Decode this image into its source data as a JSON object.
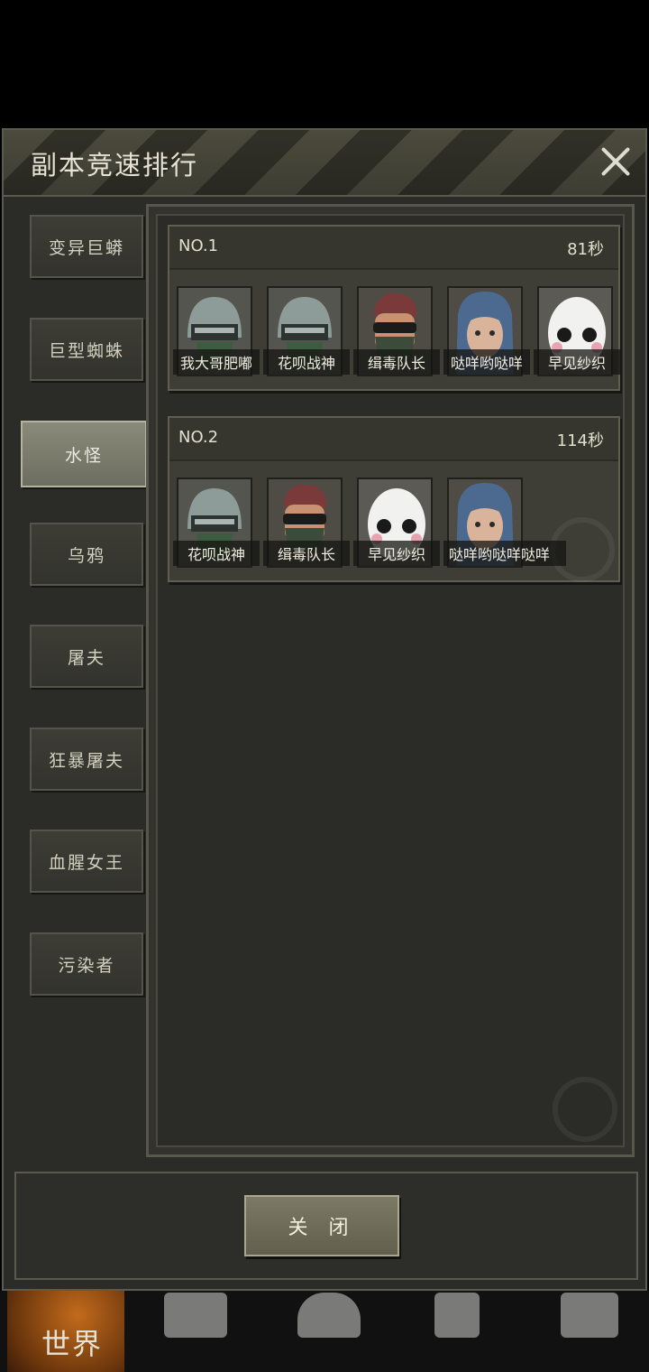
{
  "dialog": {
    "title": "副本竞速排行",
    "close_button_label": "关 闭"
  },
  "tabs": [
    {
      "label": "变异巨蟒",
      "active": false
    },
    {
      "label": "巨型蜘蛛",
      "active": false
    },
    {
      "label": "水怪",
      "active": true
    },
    {
      "label": "乌鸦",
      "active": false
    },
    {
      "label": "屠夫",
      "active": false
    },
    {
      "label": "狂暴屠夫",
      "active": false
    },
    {
      "label": "血腥女王",
      "active": false
    },
    {
      "label": "污染者",
      "active": false
    }
  ],
  "rankings": [
    {
      "rank": "NO.1",
      "time": "81秒",
      "members": [
        {
          "name": "我大哥肥嘟",
          "avatar": "helmet-soldier-icon"
        },
        {
          "name": "花呗战神",
          "avatar": "helmet-soldier-icon"
        },
        {
          "name": "缉毒队长",
          "avatar": "masked-man-icon"
        },
        {
          "name": "哒咩哟哒咩",
          "avatar": "blue-hair-girl-icon"
        },
        {
          "name": "早见纱织",
          "avatar": "white-mask-icon"
        }
      ]
    },
    {
      "rank": "NO.2",
      "time": "114秒",
      "members": [
        {
          "name": "花呗战神",
          "avatar": "helmet-soldier-icon"
        },
        {
          "name": "缉毒队长",
          "avatar": "masked-man-icon"
        },
        {
          "name": "早见纱织",
          "avatar": "white-mask-icon"
        },
        {
          "name": "哒咩哟哒咩哒咩",
          "avatar": "blue-hair-girl-icon"
        }
      ]
    }
  ],
  "bottom_nav": {
    "world_label": "世界",
    "icons": [
      "backpack-icon",
      "character-icon",
      "phone-icon",
      "shop-cart-icon"
    ]
  }
}
